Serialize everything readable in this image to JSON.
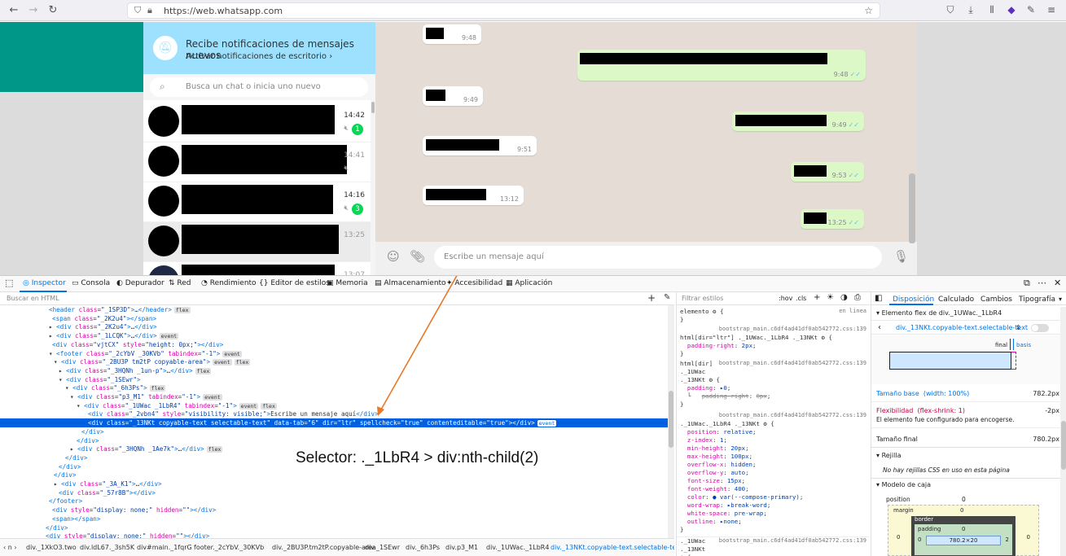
{
  "browser": {
    "url": "https://web.whatsapp.com"
  },
  "whatsapp": {
    "notification": {
      "title": "Recibe notificaciones de mensajes nuevos",
      "subtitle": "Activar notificaciones de escritorio ›"
    },
    "search_placeholder": "Busca un chat o inicia uno nuevo",
    "chats": [
      {
        "time": "14:42",
        "badge": "1",
        "muted": true
      },
      {
        "time": "14:41",
        "badge": "",
        "muted": true
      },
      {
        "time": "14:16",
        "badge": "3",
        "muted": true
      },
      {
        "time": "13:25",
        "badge": "",
        "muted": false
      },
      {
        "time": "13:07",
        "badge": "",
        "muted": false
      }
    ],
    "messages": [
      {
        "dir": "in",
        "time": "9:48"
      },
      {
        "dir": "out",
        "time": "9:48"
      },
      {
        "dir": "in",
        "time": "9:49"
      },
      {
        "dir": "out",
        "time": "9:49"
      },
      {
        "dir": "in",
        "time": "9:51"
      },
      {
        "dir": "out",
        "time": "9:53"
      },
      {
        "dir": "in",
        "time": "13:12"
      },
      {
        "dir": "out",
        "time": "13:25"
      }
    ],
    "compose_placeholder": "Escribe un mensaje aquí"
  },
  "devtools": {
    "tabs": [
      "Inspector",
      "Consola",
      "Depurador",
      "Red",
      "Rendimiento",
      "Editor de estilos",
      "Memoria",
      "Almacenamiento",
      "Accesibilidad",
      "Aplicación"
    ],
    "html_search_placeholder": "Buscar en HTML",
    "breadcrumbs": [
      "div._1XkO3.two",
      "div.ldL67._3sh5K",
      "div#main._1fqrG",
      "footer._2cYbV._30KVb",
      "div._2BU3P.tm2tP.copyable-area",
      "div._1SEwr",
      "div._6h3Ps",
      "div.p3_M1",
      "div._1UWac._1LbR4",
      "div._13NKt.copyable-text.selectable-text"
    ],
    "annotation": "Selector: ._1LbR4 > div:nth-child(2)",
    "rules": {
      "filter_placeholder": "Filtrar estilos",
      "hov": ":hov",
      "cls": ".cls",
      "element_label": "elemento",
      "inline_label": "en línea",
      "source": "bootstrap_main.c6df4ad41df0ab542772.css:139",
      "sel1": "html[dir=\"ltr\"] ._1UWac._1LbR4 ._13NKt",
      "sel2": "html[dir] ._1UWac ._13NKt",
      "sel3": "._1UWac._1LbR4 ._13NKt",
      "sel4": "._1UWac ._13NKt"
    },
    "layout": {
      "tabs": [
        "Disposición",
        "Calculado",
        "Cambios",
        "Tipografía"
      ],
      "flex_item_header": "Elemento flex de div._1UWac._1LbR4",
      "flex_select": "div._13NKt.copyable-text.selectable-text",
      "final_label": "final",
      "basis_label": "basis",
      "base_size_label": "Tamaño base",
      "base_size_detail": "(width: 100%)",
      "base_size_value": "782.2px",
      "flex_label": "Flexibilidad",
      "flex_detail": "(flex-shrink: 1)",
      "flex_value": "-2px",
      "flex_note": "El elemento fue configurado para encogerse.",
      "final_size_label": "Tamaño final",
      "final_size_value": "780.2px",
      "grid_header": "Rejilla",
      "grid_note": "No hay rejillas CSS en uso en esta página",
      "box_header": "Modelo de caja",
      "box_position": "position",
      "box_margin": "margin",
      "box_border": "border",
      "box_padding": "padding",
      "box_content": "780.2×20"
    }
  }
}
